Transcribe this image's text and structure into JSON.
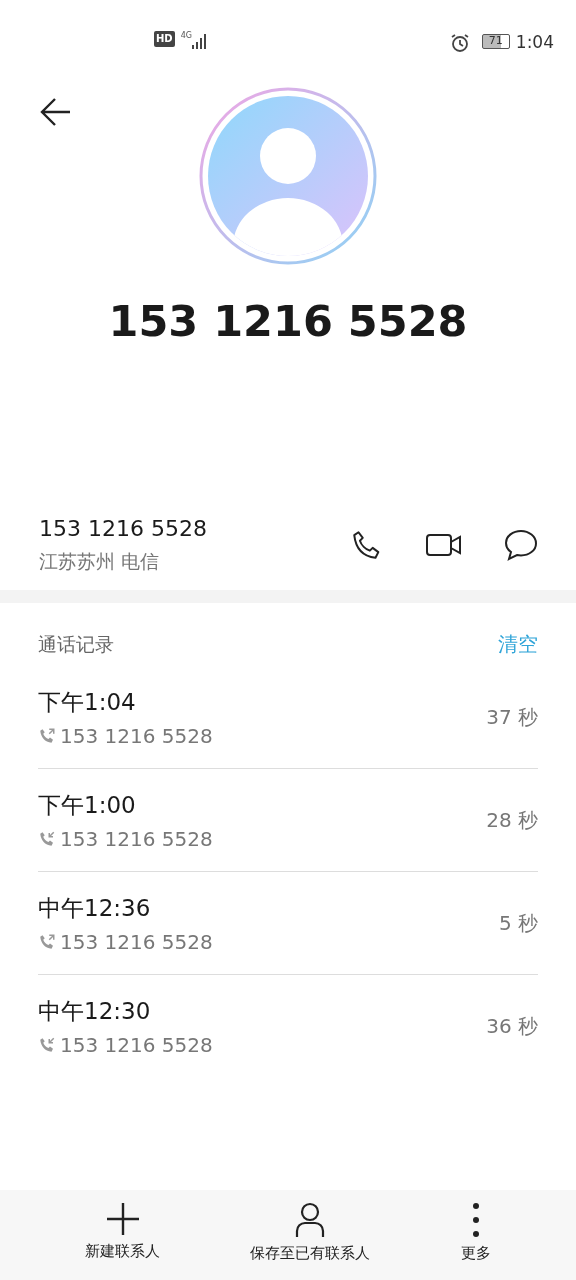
{
  "status_bar": {
    "hd": "HD",
    "network": "4G",
    "battery": "71",
    "time": "1:04"
  },
  "contact": {
    "title": "153 1216 5528",
    "number": "153 1216 5528",
    "location": "江苏苏州 电信"
  },
  "call_log": {
    "title": "通话记录",
    "clear": "清空",
    "rows": [
      {
        "time": "下午1:04",
        "kind": "outgoing",
        "number": "153 1216 5528",
        "duration": "37 秒"
      },
      {
        "time": "下午1:00",
        "kind": "incoming",
        "number": "153 1216 5528",
        "duration": "28 秒"
      },
      {
        "time": "中午12:36",
        "kind": "outgoing",
        "number": "153 1216 5528",
        "duration": "5 秒"
      },
      {
        "time": "中午12:30",
        "kind": "incoming",
        "number": "153 1216 5528",
        "duration": "36 秒"
      }
    ]
  },
  "bottom_bar": [
    {
      "kind": "add",
      "label": "新建联系人"
    },
    {
      "kind": "person",
      "label": "保存至已有联系人"
    },
    {
      "kind": "more",
      "label": "更多"
    }
  ]
}
